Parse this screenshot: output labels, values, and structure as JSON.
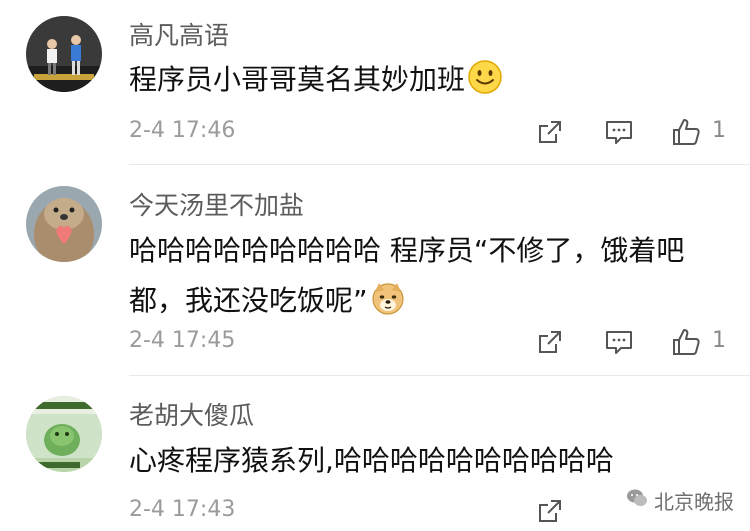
{
  "comments": [
    {
      "username": "高凡高语",
      "text_lines": [
        "程序员小哥哥莫名其妙加班"
      ],
      "emoji": "smile-emoji",
      "time": "2-4 17:46",
      "likes": "1"
    },
    {
      "username": "今天汤里不加盐",
      "text_lines": [
        "哈哈哈哈哈哈哈哈哈 程序员“不修了，饿着吧",
        "都，我还没吃饭呢”"
      ],
      "emoji": "doge-emoji",
      "time": "2-4 17:45",
      "likes": "1"
    },
    {
      "username": "老胡大傻瓜",
      "text_lines": [
        "心疼程序猿系列,哈哈哈哈哈哈哈哈哈哈"
      ],
      "emoji": "",
      "time": "2-4 17:43",
      "likes": ""
    }
  ],
  "watermark": "北京晚报",
  "icons": {
    "share": "share-icon",
    "comment": "comment-icon",
    "like": "thumbs-up-icon"
  }
}
